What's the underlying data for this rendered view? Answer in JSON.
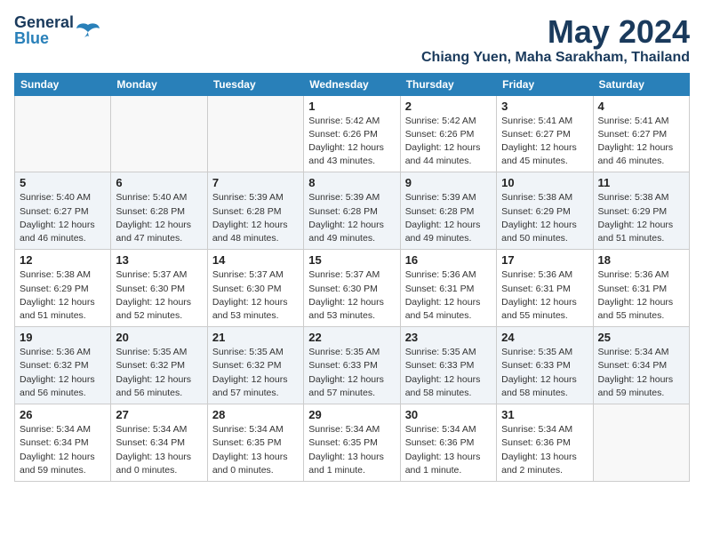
{
  "header": {
    "logo": {
      "general": "General",
      "blue": "Blue"
    },
    "title": "May 2024",
    "location": "Chiang Yuen, Maha Sarakham, Thailand"
  },
  "weekdays": [
    "Sunday",
    "Monday",
    "Tuesday",
    "Wednesday",
    "Thursday",
    "Friday",
    "Saturday"
  ],
  "weeks": [
    [
      {
        "day": "",
        "info": ""
      },
      {
        "day": "",
        "info": ""
      },
      {
        "day": "",
        "info": ""
      },
      {
        "day": "1",
        "info": "Sunrise: 5:42 AM\nSunset: 6:26 PM\nDaylight: 12 hours\nand 43 minutes."
      },
      {
        "day": "2",
        "info": "Sunrise: 5:42 AM\nSunset: 6:26 PM\nDaylight: 12 hours\nand 44 minutes."
      },
      {
        "day": "3",
        "info": "Sunrise: 5:41 AM\nSunset: 6:27 PM\nDaylight: 12 hours\nand 45 minutes."
      },
      {
        "day": "4",
        "info": "Sunrise: 5:41 AM\nSunset: 6:27 PM\nDaylight: 12 hours\nand 46 minutes."
      }
    ],
    [
      {
        "day": "5",
        "info": "Sunrise: 5:40 AM\nSunset: 6:27 PM\nDaylight: 12 hours\nand 46 minutes."
      },
      {
        "day": "6",
        "info": "Sunrise: 5:40 AM\nSunset: 6:28 PM\nDaylight: 12 hours\nand 47 minutes."
      },
      {
        "day": "7",
        "info": "Sunrise: 5:39 AM\nSunset: 6:28 PM\nDaylight: 12 hours\nand 48 minutes."
      },
      {
        "day": "8",
        "info": "Sunrise: 5:39 AM\nSunset: 6:28 PM\nDaylight: 12 hours\nand 49 minutes."
      },
      {
        "day": "9",
        "info": "Sunrise: 5:39 AM\nSunset: 6:28 PM\nDaylight: 12 hours\nand 49 minutes."
      },
      {
        "day": "10",
        "info": "Sunrise: 5:38 AM\nSunset: 6:29 PM\nDaylight: 12 hours\nand 50 minutes."
      },
      {
        "day": "11",
        "info": "Sunrise: 5:38 AM\nSunset: 6:29 PM\nDaylight: 12 hours\nand 51 minutes."
      }
    ],
    [
      {
        "day": "12",
        "info": "Sunrise: 5:38 AM\nSunset: 6:29 PM\nDaylight: 12 hours\nand 51 minutes."
      },
      {
        "day": "13",
        "info": "Sunrise: 5:37 AM\nSunset: 6:30 PM\nDaylight: 12 hours\nand 52 minutes."
      },
      {
        "day": "14",
        "info": "Sunrise: 5:37 AM\nSunset: 6:30 PM\nDaylight: 12 hours\nand 53 minutes."
      },
      {
        "day": "15",
        "info": "Sunrise: 5:37 AM\nSunset: 6:30 PM\nDaylight: 12 hours\nand 53 minutes."
      },
      {
        "day": "16",
        "info": "Sunrise: 5:36 AM\nSunset: 6:31 PM\nDaylight: 12 hours\nand 54 minutes."
      },
      {
        "day": "17",
        "info": "Sunrise: 5:36 AM\nSunset: 6:31 PM\nDaylight: 12 hours\nand 55 minutes."
      },
      {
        "day": "18",
        "info": "Sunrise: 5:36 AM\nSunset: 6:31 PM\nDaylight: 12 hours\nand 55 minutes."
      }
    ],
    [
      {
        "day": "19",
        "info": "Sunrise: 5:36 AM\nSunset: 6:32 PM\nDaylight: 12 hours\nand 56 minutes."
      },
      {
        "day": "20",
        "info": "Sunrise: 5:35 AM\nSunset: 6:32 PM\nDaylight: 12 hours\nand 56 minutes."
      },
      {
        "day": "21",
        "info": "Sunrise: 5:35 AM\nSunset: 6:32 PM\nDaylight: 12 hours\nand 57 minutes."
      },
      {
        "day": "22",
        "info": "Sunrise: 5:35 AM\nSunset: 6:33 PM\nDaylight: 12 hours\nand 57 minutes."
      },
      {
        "day": "23",
        "info": "Sunrise: 5:35 AM\nSunset: 6:33 PM\nDaylight: 12 hours\nand 58 minutes."
      },
      {
        "day": "24",
        "info": "Sunrise: 5:35 AM\nSunset: 6:33 PM\nDaylight: 12 hours\nand 58 minutes."
      },
      {
        "day": "25",
        "info": "Sunrise: 5:34 AM\nSunset: 6:34 PM\nDaylight: 12 hours\nand 59 minutes."
      }
    ],
    [
      {
        "day": "26",
        "info": "Sunrise: 5:34 AM\nSunset: 6:34 PM\nDaylight: 12 hours\nand 59 minutes."
      },
      {
        "day": "27",
        "info": "Sunrise: 5:34 AM\nSunset: 6:34 PM\nDaylight: 13 hours\nand 0 minutes."
      },
      {
        "day": "28",
        "info": "Sunrise: 5:34 AM\nSunset: 6:35 PM\nDaylight: 13 hours\nand 0 minutes."
      },
      {
        "day": "29",
        "info": "Sunrise: 5:34 AM\nSunset: 6:35 PM\nDaylight: 13 hours\nand 1 minute."
      },
      {
        "day": "30",
        "info": "Sunrise: 5:34 AM\nSunset: 6:36 PM\nDaylight: 13 hours\nand 1 minute."
      },
      {
        "day": "31",
        "info": "Sunrise: 5:34 AM\nSunset: 6:36 PM\nDaylight: 13 hours\nand 2 minutes."
      },
      {
        "day": "",
        "info": ""
      }
    ]
  ]
}
